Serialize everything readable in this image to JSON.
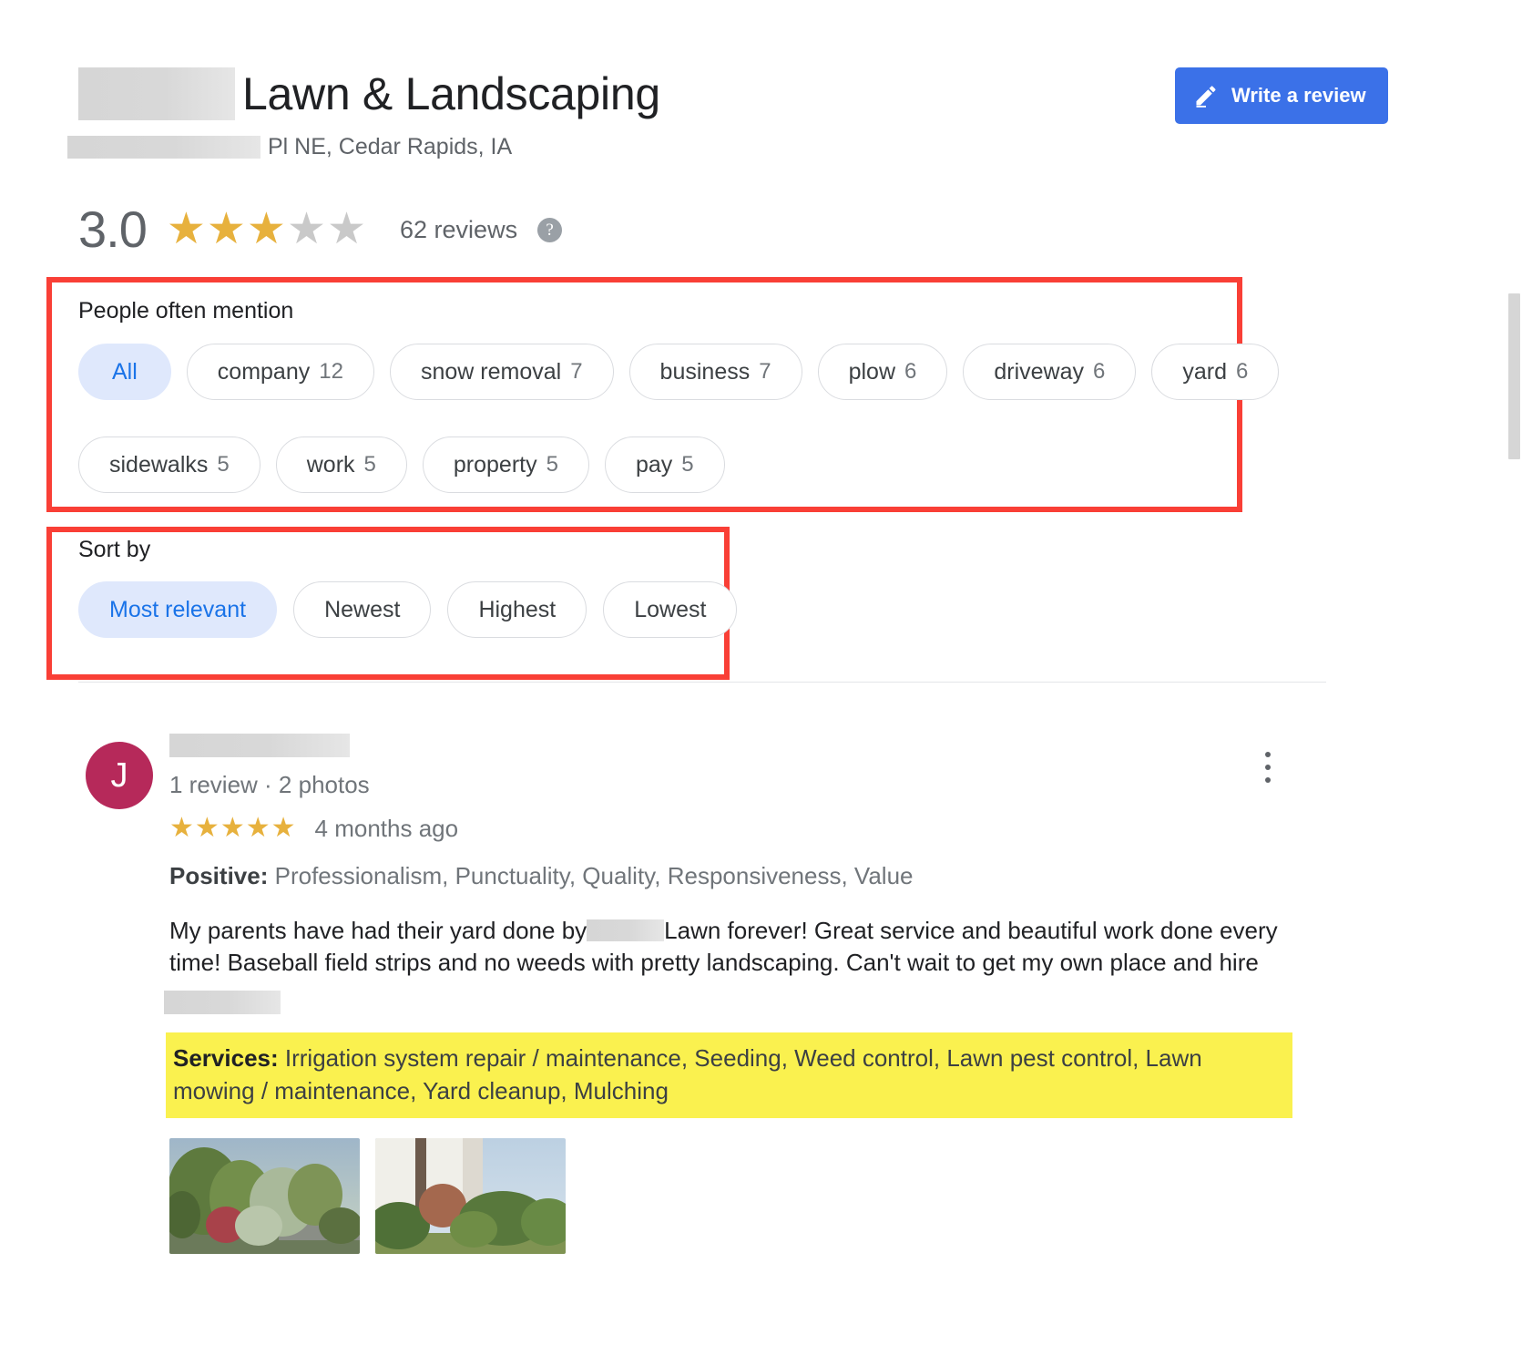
{
  "header": {
    "business_name": "Lawn & Landscaping",
    "address": "Pl NE, Cedar Rapids, IA",
    "write_review_label": "Write a review",
    "write_review_icon": "pencil-icon"
  },
  "rating": {
    "score": "3.0",
    "filled_stars": 3,
    "total_stars": 5,
    "review_count_label": "62 reviews",
    "help_icon": "help-question-icon",
    "star_filled_color": "#e7b13d",
    "star_empty_color": "#c9c9c9"
  },
  "mentions": {
    "label": "People often mention",
    "chips": [
      {
        "label": "All",
        "count": "",
        "selected": true
      },
      {
        "label": "company",
        "count": "12",
        "selected": false
      },
      {
        "label": "snow removal",
        "count": "7",
        "selected": false
      },
      {
        "label": "business",
        "count": "7",
        "selected": false
      },
      {
        "label": "plow",
        "count": "6",
        "selected": false
      },
      {
        "label": "driveway",
        "count": "6",
        "selected": false
      },
      {
        "label": "yard",
        "count": "6",
        "selected": false
      },
      {
        "label": "sidewalks",
        "count": "5",
        "selected": false
      },
      {
        "label": "work",
        "count": "5",
        "selected": false
      },
      {
        "label": "property",
        "count": "5",
        "selected": false
      },
      {
        "label": "pay",
        "count": "5",
        "selected": false
      }
    ]
  },
  "sort": {
    "label": "Sort by",
    "options": [
      {
        "label": "Most relevant",
        "selected": true
      },
      {
        "label": "Newest",
        "selected": false
      },
      {
        "label": "Highest",
        "selected": false
      },
      {
        "label": "Lowest",
        "selected": false
      }
    ]
  },
  "review": {
    "avatar_initial": "J",
    "avatar_color": "#b6295a",
    "author_name_redacted": true,
    "meta": "1 review · 2 photos",
    "stars": 5,
    "date": "4 months ago",
    "positive_label": "Positive:",
    "positive_values": "Professionalism, Punctuality, Quality, Responsiveness, Value",
    "body_part_1": "My parents have had their yard done by",
    "body_part_2": "Lawn forever! Great service and beautiful work done every time! Baseball field strips and no weeds with pretty landscaping. Can't wait to get my own place and hire",
    "services_label": "Services:",
    "services_values": "Irrigation system repair / maintenance, Seeding, Weed control, Lawn pest control, Lawn mowing / maintenance, Yard cleanup, Mulching",
    "services_highlight_color": "#faf14f",
    "menu_icon": "kebab-menu-icon",
    "photo_count": 2
  },
  "annotations": {
    "highlight_border_color": "#f93f36",
    "boxes": [
      "people-often-mention",
      "sort-by"
    ]
  }
}
